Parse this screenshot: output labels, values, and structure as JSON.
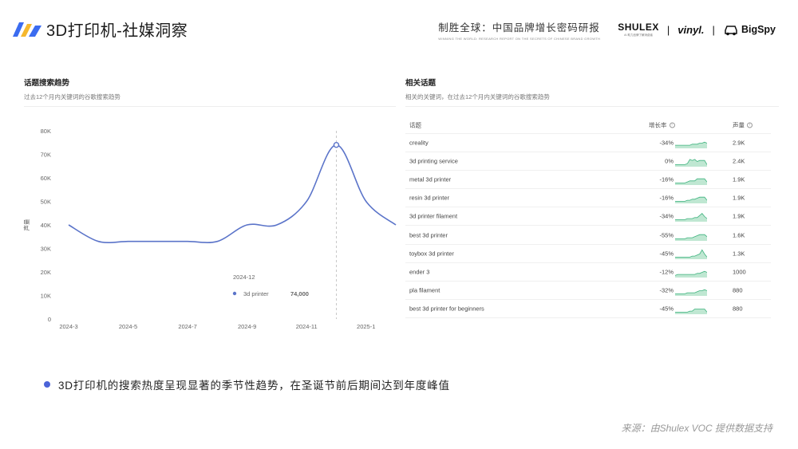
{
  "header": {
    "title": "3D打印机-社媒洞察",
    "brand_cn": "制胜全球：中国品牌增长密码研报",
    "brand_en": "WINNING THE WORLD: RESEARCH REPORT ON THE SECRETS OF CHINESE BRAND GROWTH",
    "shulex": "SHULEX",
    "shulex_sub": "AI 助力品牌了解消费者",
    "sep": "|",
    "vinyl": "vinyl.",
    "bigspy": "BigSpy"
  },
  "left_panel": {
    "title": "话题搜索趋势",
    "subtitle": "过去12个月内关键词的谷歌搜索趋势"
  },
  "right_panel": {
    "title": "相关话题",
    "subtitle": "相关的关键词，在过去12个月内关键词的谷歌搜索趋势",
    "columns": {
      "topic": "话题",
      "growth": "增长率",
      "volume": "声量"
    },
    "info_glyph": "i",
    "rows": [
      {
        "topic": "creality",
        "growth": "-34%",
        "volume": "2.9K",
        "spark": [
          3,
          3,
          3,
          3,
          3,
          3,
          3,
          4,
          4,
          4,
          5,
          5,
          6,
          5
        ]
      },
      {
        "topic": "3d printing service",
        "growth": "0%",
        "volume": "2.4K",
        "spark": [
          2,
          2,
          2,
          2,
          2,
          3,
          7,
          6,
          7,
          5,
          6,
          6,
          6,
          2
        ]
      },
      {
        "topic": "metal 3d printer",
        "growth": "-16%",
        "volume": "1.9K",
        "spark": [
          2,
          2,
          2,
          2,
          2,
          3,
          4,
          4,
          4,
          6,
          6,
          6,
          6,
          3
        ]
      },
      {
        "topic": "resin 3d printer",
        "growth": "-16%",
        "volume": "1.9K",
        "spark": [
          2,
          2,
          2,
          2,
          2,
          3,
          3,
          4,
          4,
          5,
          6,
          6,
          6,
          3
        ]
      },
      {
        "topic": "3d printer filament",
        "growth": "-34%",
        "volume": "1.9K",
        "spark": [
          2,
          2,
          2,
          2,
          2,
          3,
          3,
          3,
          4,
          4,
          6,
          8,
          5,
          3
        ]
      },
      {
        "topic": "best 3d printer",
        "growth": "-55%",
        "volume": "1.6K",
        "spark": [
          2,
          2,
          2,
          2,
          2,
          3,
          3,
          3,
          4,
          5,
          6,
          6,
          6,
          4
        ]
      },
      {
        "topic": "toybox 3d printer",
        "growth": "-45%",
        "volume": "1.3K",
        "spark": [
          2,
          2,
          2,
          2,
          2,
          2,
          2,
          3,
          3,
          4,
          5,
          9,
          5,
          2
        ]
      },
      {
        "topic": "ender 3",
        "growth": "-12%",
        "volume": "1000",
        "spark": [
          2,
          3,
          3,
          3,
          3,
          3,
          3,
          3,
          3,
          4,
          4,
          5,
          6,
          5
        ]
      },
      {
        "topic": "pla filament",
        "growth": "-32%",
        "volume": "880",
        "spark": [
          2,
          2,
          2,
          2,
          2,
          3,
          3,
          3,
          3,
          4,
          5,
          5,
          6,
          5
        ]
      },
      {
        "topic": "best 3d printer for beginners",
        "growth": "-45%",
        "volume": "880",
        "spark": [
          2,
          2,
          2,
          2,
          2,
          2,
          3,
          3,
          5,
          5,
          5,
          5,
          5,
          2
        ]
      }
    ]
  },
  "chart_data": {
    "type": "line",
    "title": "",
    "xlabel": "",
    "ylabel": "声量",
    "ylim": [
      0,
      80000
    ],
    "y_ticks": [
      0,
      10000,
      20000,
      30000,
      40000,
      50000,
      60000,
      70000,
      80000
    ],
    "y_tick_labels": [
      "0",
      "10K",
      "20K",
      "30K",
      "40K",
      "50K",
      "60K",
      "70K",
      "80K"
    ],
    "x_tick_labels": [
      "2024-3",
      "2024-5",
      "2024-7",
      "2024-9",
      "2024-11",
      "2025-1"
    ],
    "x_tick_index": [
      0,
      2,
      4,
      6,
      8,
      10
    ],
    "x": [
      "2024-3",
      "2024-4",
      "2024-5",
      "2024-6",
      "2024-7",
      "2024-8",
      "2024-9",
      "2024-10",
      "2024-11",
      "2024-12",
      "2025-1",
      "2025-2"
    ],
    "series": [
      {
        "name": "3d printer",
        "color": "#5b74c9",
        "values": [
          40000,
          33000,
          33000,
          33000,
          33000,
          33000,
          40000,
          40000,
          50000,
          74000,
          50000,
          40000
        ]
      }
    ],
    "grid": false,
    "tooltip": {
      "label": "2024-12",
      "series": "3d printer",
      "value": "74,000",
      "index": 9
    }
  },
  "summary": {
    "bullet": "3D打印机的搜索热度呈现显著的季节性趋势，在圣诞节前后期间达到年度峰值"
  },
  "source": "来源：由Shulex VOC 提供数据支持",
  "colors": {
    "accent": "#4b63d8",
    "line": "#5b74c9",
    "spark_fill": "#bfe7d2",
    "spark_line": "#3fb37f"
  }
}
